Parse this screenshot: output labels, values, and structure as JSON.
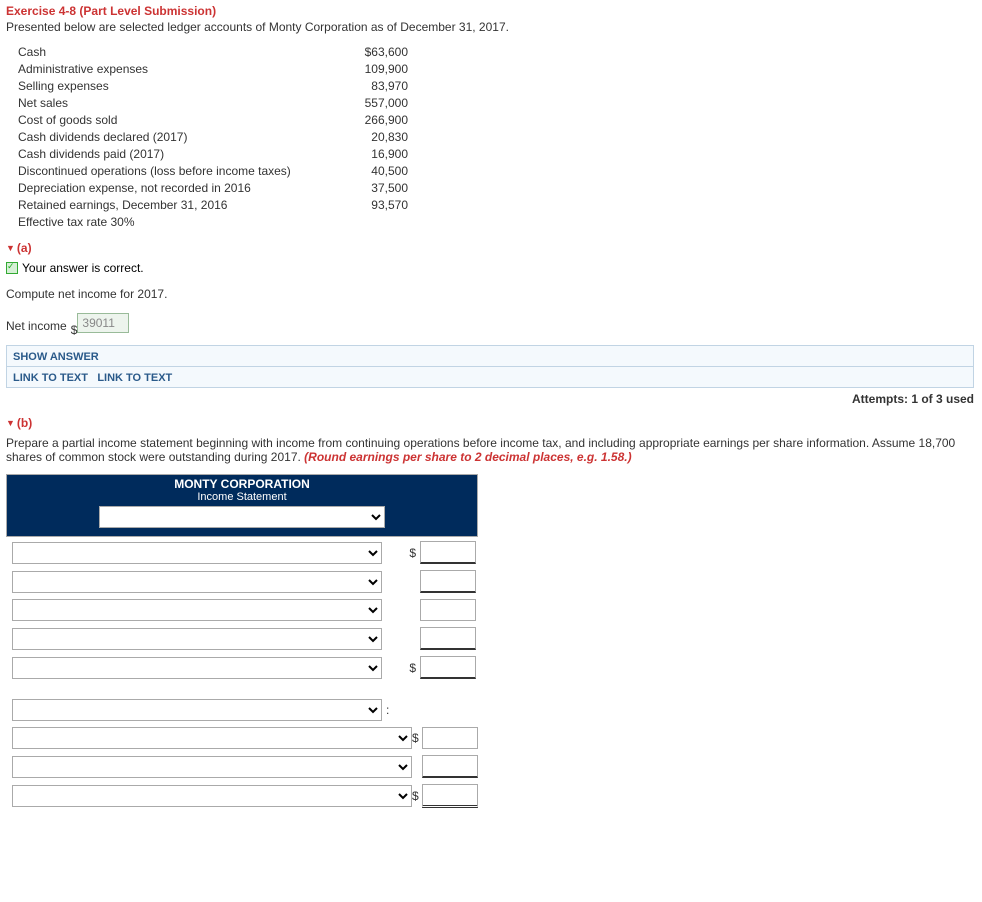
{
  "title": "Exercise 4-8 (Part Level Submission)",
  "intro": "Presented below are selected ledger accounts of Monty Corporation as of December 31, 2017.",
  "ledger": [
    {
      "label": "Cash",
      "value": "$63,600"
    },
    {
      "label": "Administrative expenses",
      "value": "109,900"
    },
    {
      "label": "Selling expenses",
      "value": "83,970"
    },
    {
      "label": "Net sales",
      "value": "557,000"
    },
    {
      "label": "Cost of goods sold",
      "value": "266,900"
    },
    {
      "label": "Cash dividends declared (2017)",
      "value": "20,830"
    },
    {
      "label": "Cash dividends paid (2017)",
      "value": "16,900"
    },
    {
      "label": "Discontinued operations (loss before income taxes)",
      "value": "40,500"
    },
    {
      "label": "Depreciation expense, not recorded in 2016",
      "value": "37,500"
    },
    {
      "label": "Retained earnings, December 31, 2016",
      "value": "93,570"
    },
    {
      "label": "Effective tax rate 30%",
      "value": ""
    }
  ],
  "part_a": {
    "header": "(a)",
    "correct_msg": "Your answer is correct.",
    "compute": "Compute net income for 2017.",
    "net_income_label": "Net income",
    "net_income_value": "39011"
  },
  "links": {
    "show_answer": "SHOW ANSWER",
    "link_to_text": "LINK TO TEXT"
  },
  "attempts": "Attempts: 1 of 3 used",
  "part_b": {
    "header": "(b)",
    "text_pre": "Prepare a partial income statement beginning with income from continuing operations before income tax, and including appropriate earnings per share information. Assume 18,700 shares of common stock were outstanding during 2017. ",
    "text_red": "(Round earnings per share to 2 decimal places, e.g. 1.58.)",
    "corp_name": "MONTY CORPORATION",
    "stmt_title": "Income Statement",
    "dollar": "$",
    "colon": ":"
  }
}
